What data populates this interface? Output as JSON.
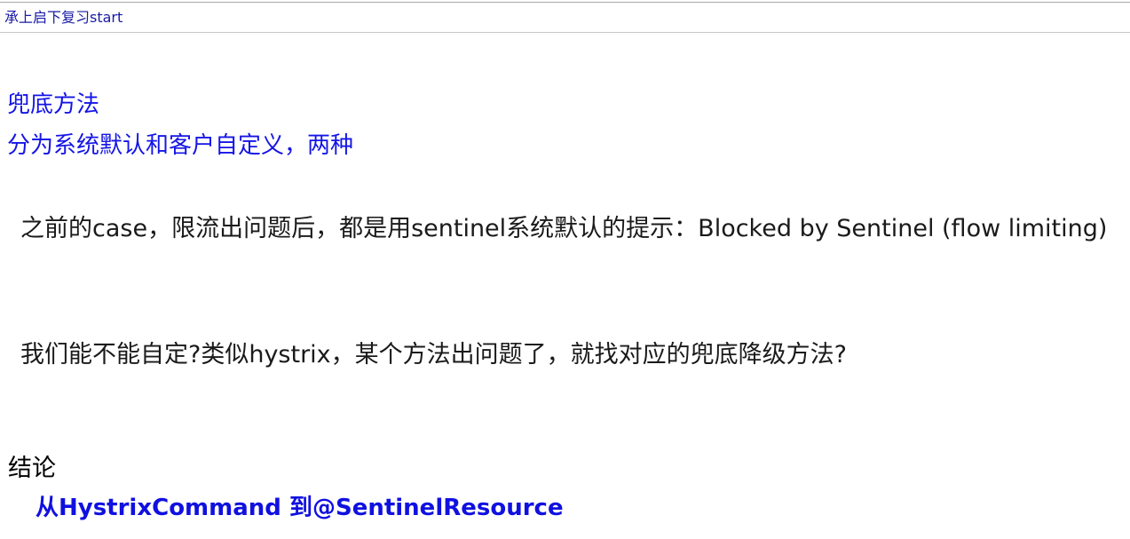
{
  "header": {
    "link_text": "承上启下复习start"
  },
  "section": {
    "heading": "兜底方法",
    "subheading": "分为系统默认和客户自定义，两种"
  },
  "paragraphs": [
    "之前的case，限流出问题后，都是用sentinel系统默认的提示：Blocked by Sentinel (flow limiting)",
    "我们能不能自定?类似hystrix，某个方法出问题了，就找对应的兜底降级方法?"
  ],
  "conclusion": {
    "title": "结论",
    "text": "从HystrixCommand 到@SentinelResource"
  }
}
